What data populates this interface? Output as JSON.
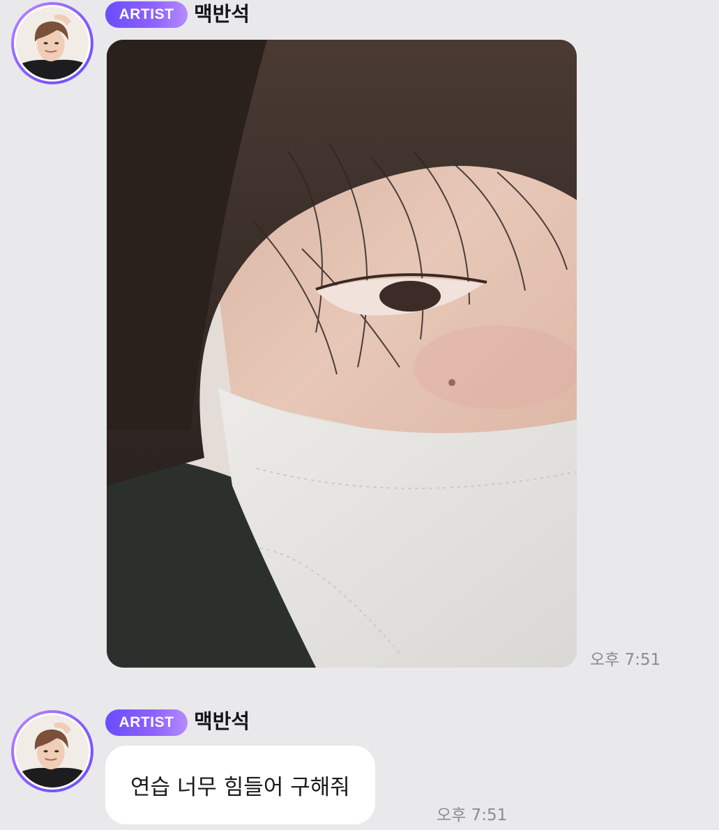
{
  "messages": [
    {
      "sender": {
        "badge": "ARTIST",
        "name": "맥반석"
      },
      "kind": "photo",
      "time": "오후 7:51"
    },
    {
      "sender": {
        "badge": "ARTIST",
        "name": "맥반석"
      },
      "kind": "text",
      "text": "연습 너무 힘들어 구해줘",
      "time": "오후 7:51"
    }
  ],
  "colors": {
    "background": "#e9e9ec",
    "badge_gradient_start": "#6b4cff",
    "badge_gradient_end": "#b58bff",
    "avatar_ring": "#8a5cff",
    "bubble": "#ffffff",
    "timestamp": "#8c8c8c"
  }
}
